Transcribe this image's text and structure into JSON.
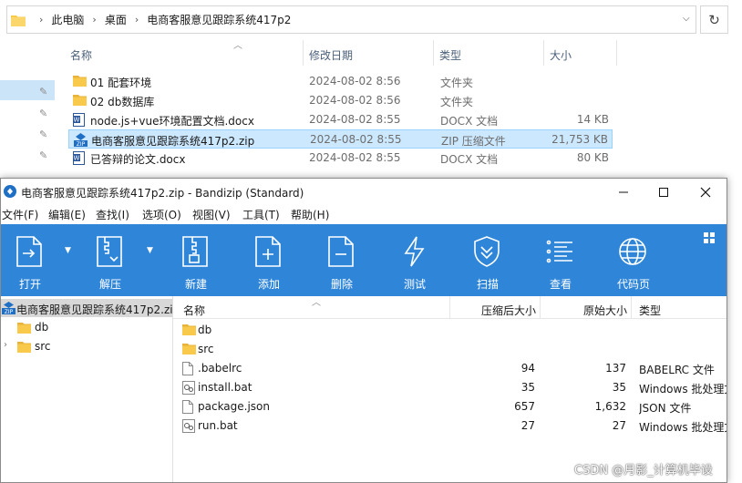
{
  "explorer": {
    "breadcrumb": [
      "此电脑",
      "桌面",
      "电商客服意见跟踪系统417p2"
    ],
    "columns": {
      "name": "名称",
      "date": "修改日期",
      "type": "类型",
      "size": "大小"
    },
    "files": [
      {
        "icon": "folder-icon",
        "name": "01  配套环境",
        "date": "2024-08-02 8:56",
        "type": "文件夹",
        "size": ""
      },
      {
        "icon": "folder-icon",
        "name": "02 db数据库",
        "date": "2024-08-02 8:56",
        "type": "文件夹",
        "size": ""
      },
      {
        "icon": "word-doc-icon",
        "name": "node.js+vue环境配置文档.docx",
        "date": "2024-08-02 8:55",
        "type": "DOCX 文档",
        "size": "14 KB"
      },
      {
        "icon": "zip-file-icon",
        "name": "电商客服意见跟踪系统417p2.zip",
        "date": "2024-08-02 8:55",
        "type": "ZIP 压缩文件",
        "size": "21,753 KB",
        "selected": true
      },
      {
        "icon": "word-doc-icon",
        "name": "已答辩的论文.docx",
        "date": "2024-08-02 8:55",
        "type": "DOCX 文档",
        "size": "80 KB"
      }
    ]
  },
  "bandizip": {
    "title": "电商客服意见跟踪系统417p2.zip - Bandizip (Standard)",
    "menu": [
      "文件(F)",
      "编辑(E)",
      "查找(I)",
      "选项(O)",
      "视图(V)",
      "工具(T)",
      "帮助(H)"
    ],
    "toolbar": [
      "打开",
      "解压",
      "新建",
      "添加",
      "删除",
      "测试",
      "扫描",
      "查看",
      "代码页"
    ],
    "tree": {
      "root": "电商客服意见跟踪系统417p2.zi",
      "children": [
        "db",
        "src"
      ]
    },
    "list_columns": {
      "name": "名称",
      "compressed": "压缩后大小",
      "original": "原始大小",
      "type": "类型"
    },
    "entries": [
      {
        "icon": "folder-icon",
        "name": "db",
        "compressed": "",
        "original": "",
        "type": ""
      },
      {
        "icon": "folder-icon",
        "name": "src",
        "compressed": "",
        "original": "",
        "type": ""
      },
      {
        "icon": "file-icon",
        "name": ".babelrc",
        "compressed": "94",
        "original": "137",
        "type": "BABELRC 文件"
      },
      {
        "icon": "bat-file-icon",
        "name": "install.bat",
        "compressed": "35",
        "original": "35",
        "type": "Windows 批处理文件"
      },
      {
        "icon": "file-icon",
        "name": "package.json",
        "compressed": "657",
        "original": "1,632",
        "type": "JSON 文件"
      },
      {
        "icon": "bat-file-icon",
        "name": "run.bat",
        "compressed": "27",
        "original": "27",
        "type": "Windows 批处理文件"
      }
    ]
  },
  "watermark": "CSDN @月影_计算机毕设",
  "colors": {
    "toolbar": "#2f86d9",
    "selection": "#cce8ff",
    "folder": "#f8c94a"
  }
}
